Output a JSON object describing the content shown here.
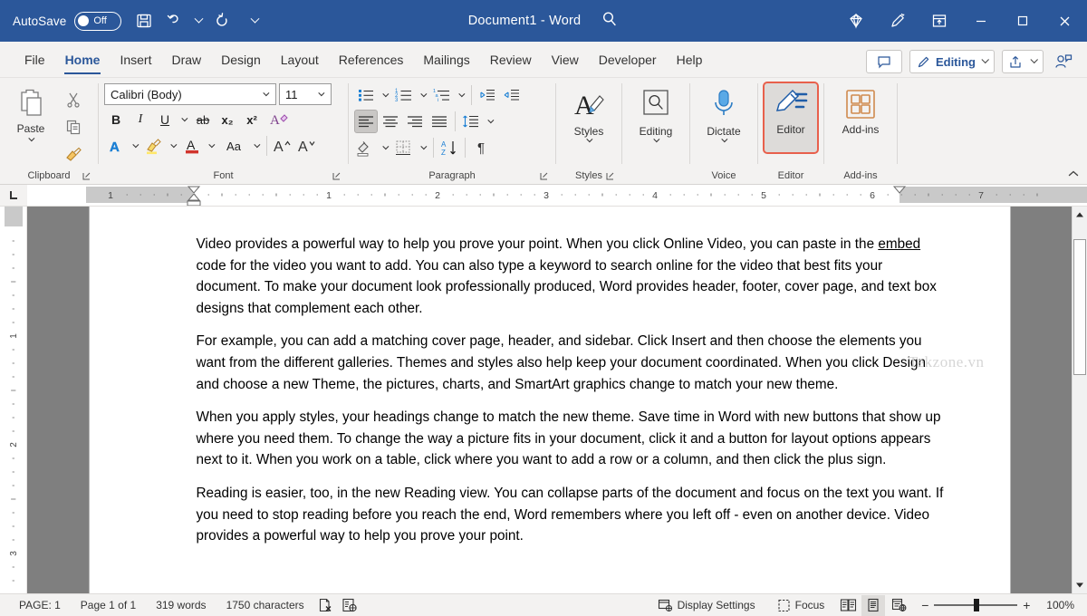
{
  "titlebar": {
    "autosave_label": "AutoSave",
    "autosave_state": "Off",
    "document_title": "Document1  -  Word",
    "quick_access": [
      "save-icon",
      "undo-icon",
      "redo-icon",
      "customize-qat-icon"
    ],
    "right_icons": [
      "diamond-icon",
      "pen-draw-icon",
      "ribbon-display-options-icon"
    ],
    "window_buttons": {
      "minimize": "─",
      "maximize": "☐",
      "close": "✕"
    },
    "bg_color": "#2b579a"
  },
  "tabs": [
    {
      "label": "File",
      "active": false
    },
    {
      "label": "Home",
      "active": true
    },
    {
      "label": "Insert",
      "active": false
    },
    {
      "label": "Draw",
      "active": false
    },
    {
      "label": "Design",
      "active": false
    },
    {
      "label": "Layout",
      "active": false
    },
    {
      "label": "References",
      "active": false
    },
    {
      "label": "Mailings",
      "active": false
    },
    {
      "label": "Review",
      "active": false
    },
    {
      "label": "View",
      "active": false
    },
    {
      "label": "Developer",
      "active": false
    },
    {
      "label": "Help",
      "active": false
    }
  ],
  "tabbar_right": {
    "comments_label": "",
    "editing_label": "Editing",
    "share_label": "",
    "accent_color": "#2b579a"
  },
  "ribbon": {
    "clipboard": {
      "group_label": "Clipboard",
      "paste_label": "Paste",
      "cut_label": "",
      "copy_label": "",
      "format_painter_label": ""
    },
    "font": {
      "group_label": "Font",
      "font_name": "Calibri (Body)",
      "font_size": "11",
      "bold": "B",
      "italic": "I",
      "underline": "U",
      "strikethrough": "ab",
      "subscript": "x₂",
      "superscript": "x²",
      "clear_formatting": "A",
      "text_effects": "A",
      "highlight": "",
      "font_color": "A",
      "change_case": "Aa",
      "grow_font": "A",
      "shrink_font": "A"
    },
    "paragraph": {
      "group_label": "Paragraph",
      "bullets": "bullets-icon",
      "numbering": "numbering-icon",
      "multilevel": "multilevel-list-icon",
      "decrease_indent": "decrease-indent-icon",
      "increase_indent": "increase-indent-icon",
      "align_left": "align-left-icon",
      "align_center": "align-center-icon",
      "align_right": "align-right-icon",
      "justify": "justify-icon",
      "line_spacing": "line-spacing-icon",
      "shading": "shading-icon",
      "borders": "borders-icon",
      "sort": "sort-icon",
      "show_marks": "¶"
    },
    "styles": {
      "group_label": "Styles",
      "button_label": "Styles"
    },
    "editing": {
      "group_label": "",
      "button_label": "Editing"
    },
    "voice": {
      "group_label": "Voice",
      "button_label": "Dictate"
    },
    "editor": {
      "group_label": "Editor",
      "button_label": "Editor",
      "highlight_color": "#e8604c"
    },
    "addins": {
      "group_label": "Add-ins",
      "button_label": "Add-ins"
    }
  },
  "ruler": {
    "horizontal_marks": [
      "1",
      "1",
      "2",
      "3",
      "4",
      "5",
      "6",
      "7"
    ],
    "vertical_marks": [
      "1",
      "2",
      "3"
    ],
    "tab_stop": "left-tab-stop-icon"
  },
  "document": {
    "watermark": "Tekzone.vn",
    "paragraphs": [
      {
        "before": "Video provides a powerful way to help you prove your point. When you click Online Video, you can paste in the ",
        "marked": "embed",
        "after": " code for the video you want to add. You can also type a keyword to search online for the video that best fits your document. To make your document look professionally produced, Word provides header, footer, cover page, and text box designs that complement each other."
      },
      {
        "before": "For example, you can add a matching cover page, header, and sidebar. Click Insert and then choose the elements you want from the different galleries. Themes and styles also help keep your document coordinated. When you click Design and choose a new Theme, the pictures, charts, and SmartArt graphics change to match your new theme.",
        "marked": "",
        "after": ""
      },
      {
        "before": "When you apply styles, your headings change to match the new theme. Save time in Word with new buttons that show up where you need them. To change the way a picture fits in your document, click it and a button for layout options appears next to it. When you work on a table, click where you want to add a row or a column, and then click the plus sign.",
        "marked": "",
        "after": ""
      },
      {
        "before": "Reading is easier, too, in the new Reading view. You can collapse parts of the document and focus on the text you want. If you need to stop reading before you reach the end, Word remembers where you left off - even on another device. Video provides a powerful way to help you prove your point.",
        "marked": "",
        "after": ""
      }
    ]
  },
  "statusbar": {
    "page_indicator": "PAGE: 1",
    "page_of": "Page 1 of 1",
    "word_count": "319 words",
    "char_count": "1750 characters",
    "proofing_icon": "proofing-errors-icon",
    "accessibility_icon": "accessibility-checker-icon",
    "display_settings": "Display Settings",
    "focus": "Focus",
    "view_read_mode": "read-mode-icon",
    "view_print_layout": "print-layout-icon",
    "view_web_layout": "web-layout-icon",
    "zoom_out": "−",
    "zoom_in": "+",
    "zoom_level": "100%"
  }
}
